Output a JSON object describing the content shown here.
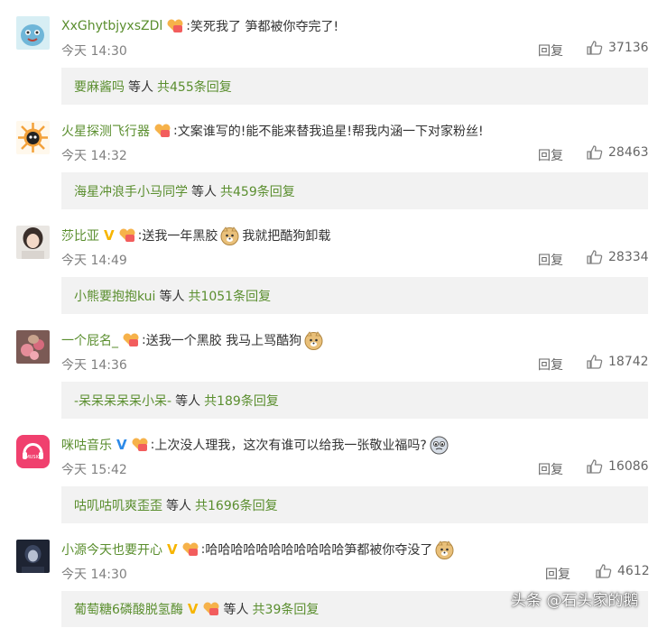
{
  "comments": [
    {
      "username": "XxGhytbjyxsZDl",
      "verified": "",
      "content_parts": [
        "笑死我了 笋都被你夺完了!"
      ],
      "time": "今天 14:30",
      "reply_label": "回复",
      "likes": "37136",
      "sub_reply": {
        "name": "要麻酱吗",
        "mid": "等人",
        "count": "共455条回复"
      }
    },
    {
      "username": "火星探测飞行器",
      "verified": "",
      "content_parts": [
        "文案谁写的!能不能来替我追星!帮我内涵一下对家粉丝!"
      ],
      "time": "今天 14:32",
      "reply_label": "回复",
      "likes": "28463",
      "sub_reply": {
        "name": "海星冲浪手小马同学",
        "mid": "等人",
        "count": "共459条回复"
      }
    },
    {
      "username": "莎比亚",
      "verified": "V",
      "content_parts": [
        "送我一年黑胶",
        "我就把酷狗卸载"
      ],
      "time": "今天 14:49",
      "reply_label": "回复",
      "likes": "28334",
      "sub_reply": {
        "name": "小熊要抱抱kui",
        "mid": "等人",
        "count": "共1051条回复"
      }
    },
    {
      "username": "一个屁名_",
      "verified": "",
      "content_parts": [
        "送我一个黑胶  我马上骂酷狗"
      ],
      "time": "今天 14:36",
      "reply_label": "回复",
      "likes": "18742",
      "sub_reply": {
        "name": "-呆呆呆呆呆小呆-",
        "mid": "等人",
        "count": "共189条回复"
      }
    },
    {
      "username": "咪咕音乐",
      "verified": "V",
      "content_parts": [
        "上次没人理我，这次有谁可以给我一张敬业福吗?"
      ],
      "time": "今天 15:42",
      "reply_label": "回复",
      "likes": "16086",
      "sub_reply": {
        "name": "咕叽咕叽爽歪歪",
        "mid": "等人",
        "count": "共1696条回复"
      }
    },
    {
      "username": "小源今天也要开心",
      "verified": "V",
      "content_parts": [
        "哈哈哈哈哈哈哈哈哈哈哈笋都被你夺没了"
      ],
      "time": "今天 14:30",
      "reply_label": "回复",
      "likes": "4612",
      "sub_reply": {
        "name": "葡萄糖6磷酸脱氢酶",
        "verified": "V",
        "mid": "等人",
        "count": "共39条回复"
      }
    }
  ],
  "watermark": "头条 @石头家的鹅",
  "colors": {
    "username": "#5a8e2e",
    "verified_gold": "#f7b500",
    "verified_blue": "#2c8ae8",
    "sub_box_bg": "#f2f2f2",
    "migu_brand": "#f0406e"
  }
}
